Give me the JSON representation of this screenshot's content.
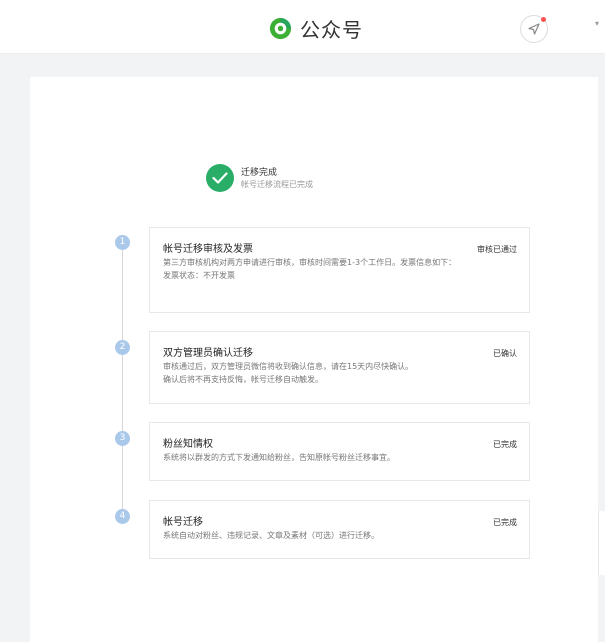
{
  "header": {
    "title": "公众号",
    "logo_icon": "wechat-official-account-logo",
    "nav_icon": "location-arrow-icon"
  },
  "status": {
    "title": "迁移完成",
    "description": "帐号迁移流程已完成",
    "icon": "check-icon"
  },
  "steps": [
    {
      "number": "1",
      "title": "帐号迁移审核及发票",
      "description": "第三方审核机构对两方申请进行审核，审核时间需要1-3个工作日。发票信息如下：",
      "extra": "发票状态：不开发票",
      "status": "审核已通过"
    },
    {
      "number": "2",
      "title": "双方管理员确认迁移",
      "description": "审核通过后，双方管理员微信将收到确认信息，请在15天内尽快确认。",
      "extra": "确认后将不再支持反悔，帐号迁移自动触发。",
      "status": "已确认"
    },
    {
      "number": "3",
      "title": "粉丝知情权",
      "description": "系统将以群发的方式下发通知给粉丝，告知原帐号粉丝迁移事宜。",
      "status": "已完成"
    },
    {
      "number": "4",
      "title": "帐号迁移",
      "description": "系统自动对粉丝、违规记录、文章及素材（可选）进行迁移。",
      "status": "已完成"
    }
  ],
  "colors": {
    "success": "#2aae67",
    "step_dot": "#a9c8ea",
    "page_background": "#f2f3f5"
  }
}
